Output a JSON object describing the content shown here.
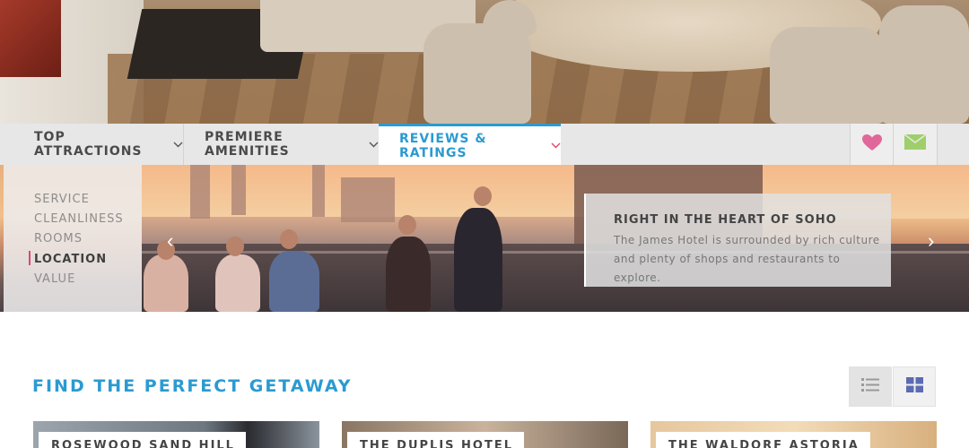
{
  "nav": {
    "tabs": [
      {
        "label": "TOP ATTRACTIONS"
      },
      {
        "label": "PREMIERE AMENITIES"
      },
      {
        "label": "REVIEWS & RATINGS"
      }
    ],
    "active_tab": "REVIEWS & RATINGS",
    "icons": {
      "favorite": "heart-icon",
      "contact": "mail-icon"
    }
  },
  "reviews": {
    "categories": [
      "SERVICE",
      "CLEANLINESS",
      "ROOMS",
      "LOCATION",
      "VALUE"
    ],
    "active_category": "LOCATION",
    "caption": {
      "heading": "RIGHT IN THE HEART OF SOHO",
      "line1": "The James Hotel is surrounded by rich culture",
      "line2": "and plenty of shops and restaurants to explore."
    },
    "prev_arrow": "‹",
    "next_arrow": "›"
  },
  "section": {
    "title": "FIND THE PERFECT GETAWAY",
    "view_options": [
      "list-view-icon",
      "grid-view-icon"
    ]
  },
  "cards": [
    {
      "title": "ROSEWOOD SAND HILL"
    },
    {
      "title": "THE DUPLIS HOTEL"
    },
    {
      "title": "THE WALDORF ASTORIA"
    }
  ],
  "colors": {
    "accent": "#2a9bd1",
    "active_marker": "#d84a6e",
    "heart": "#e0679a",
    "mail": "#9fcf6a"
  }
}
